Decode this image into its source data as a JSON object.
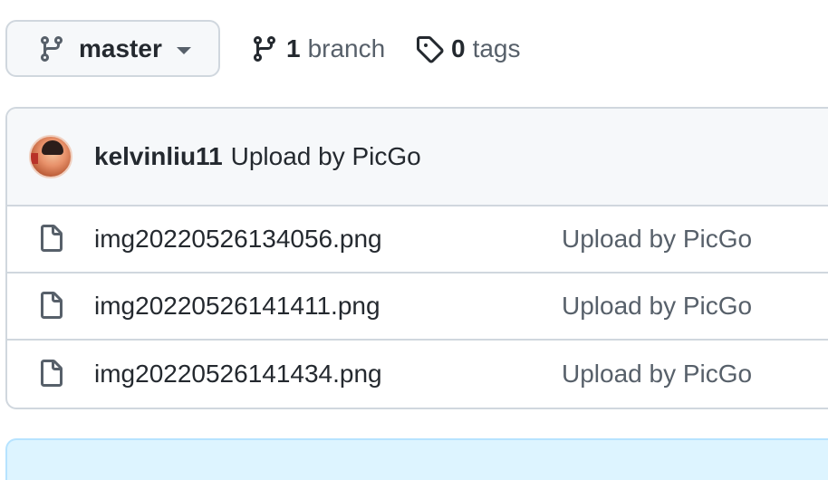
{
  "branch_selector": {
    "label": "master",
    "icon": "git-branch-icon",
    "caret_icon": "triangle-down-icon"
  },
  "branches": {
    "count": "1",
    "label": "branch",
    "icon": "git-branch-icon"
  },
  "tags": {
    "count": "0",
    "label": "tags",
    "icon": "tag-icon"
  },
  "latest_commit": {
    "author": "kelvinliu11",
    "message": "Upload by PicGo",
    "avatar": "avatar"
  },
  "files": [
    {
      "name": "img20220526134056.png",
      "commit_message": "Upload by PicGo",
      "icon": "file-icon"
    },
    {
      "name": "img20220526141411.png",
      "commit_message": "Upload by PicGo",
      "icon": "file-icon"
    },
    {
      "name": "img20220526141434.png",
      "commit_message": "Upload by PicGo",
      "icon": "file-icon"
    }
  ],
  "colors": {
    "text_primary": "#24292f",
    "text_muted": "#57606a",
    "border": "#d0d7de",
    "header_bg": "#f6f8fa",
    "flash_bg": "#ddf4ff"
  }
}
